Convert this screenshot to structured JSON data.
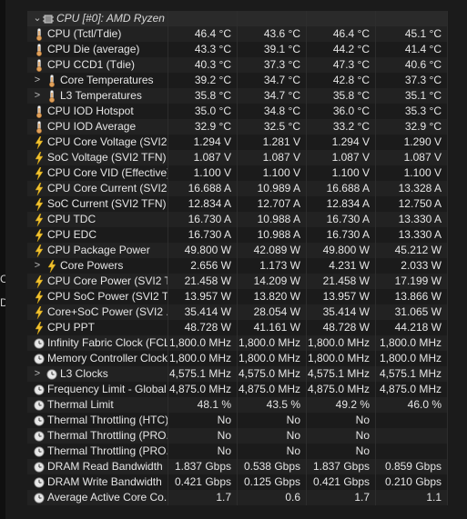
{
  "window": {
    "edge_glyphs": [
      "C",
      "D"
    ]
  },
  "group": {
    "label": "CPU [#0]: AMD Ryzen 7 ...",
    "icon": "chip-icon"
  },
  "rows": [
    {
      "icon": "thermometer-icon",
      "name": "CPU (Tctl/Tdie)",
      "v": [
        "46.4 °C",
        "43.6 °C",
        "46.4 °C",
        "45.1 °C"
      ]
    },
    {
      "icon": "thermometer-icon",
      "name": "CPU Die (average)",
      "v": [
        "43.3 °C",
        "39.1 °C",
        "44.2 °C",
        "41.4 °C"
      ]
    },
    {
      "icon": "thermometer-icon",
      "name": "CPU CCD1 (Tdie)",
      "v": [
        "40.3 °C",
        "37.3 °C",
        "47.3 °C",
        "40.6 °C"
      ]
    },
    {
      "icon": "thermometer-icon",
      "name": "Core Temperatures",
      "expand": ">",
      "sub": true,
      "v": [
        "39.2 °C",
        "34.7 °C",
        "42.8 °C",
        "37.3 °C"
      ]
    },
    {
      "icon": "thermometer-icon",
      "name": "L3 Temperatures",
      "expand": ">",
      "sub": true,
      "v": [
        "35.8 °C",
        "34.7 °C",
        "35.8 °C",
        "35.1 °C"
      ]
    },
    {
      "icon": "thermometer-icon",
      "name": "CPU IOD Hotspot",
      "v": [
        "35.0 °C",
        "34.8 °C",
        "36.0 °C",
        "35.3 °C"
      ]
    },
    {
      "icon": "thermometer-icon",
      "name": "CPU IOD Average",
      "v": [
        "32.9 °C",
        "32.5 °C",
        "33.2 °C",
        "32.9 °C"
      ]
    },
    {
      "icon": "lightning-icon",
      "name": "CPU Core Voltage (SVI2 ...",
      "v": [
        "1.294 V",
        "1.281 V",
        "1.294 V",
        "1.290 V"
      ]
    },
    {
      "icon": "lightning-icon",
      "name": "SoC Voltage (SVI2 TFN)",
      "v": [
        "1.087 V",
        "1.087 V",
        "1.087 V",
        "1.087 V"
      ]
    },
    {
      "icon": "lightning-icon",
      "name": "CPU Core VID (Effective)",
      "v": [
        "1.100 V",
        "1.100 V",
        "1.100 V",
        "1.100 V"
      ]
    },
    {
      "icon": "lightning-icon",
      "name": "CPU Core Current (SVI2 ...",
      "v": [
        "16.688 A",
        "10.989 A",
        "16.688 A",
        "13.328 A"
      ]
    },
    {
      "icon": "lightning-icon",
      "name": "SoC Current (SVI2 TFN)",
      "v": [
        "12.834 A",
        "12.707 A",
        "12.834 A",
        "12.750 A"
      ]
    },
    {
      "icon": "lightning-icon",
      "name": "CPU TDC",
      "v": [
        "16.730 A",
        "10.988 A",
        "16.730 A",
        "13.330 A"
      ]
    },
    {
      "icon": "lightning-icon",
      "name": "CPU EDC",
      "v": [
        "16.730 A",
        "10.988 A",
        "16.730 A",
        "13.330 A"
      ]
    },
    {
      "icon": "lightning-icon",
      "name": "CPU Package Power",
      "v": [
        "49.800 W",
        "42.089 W",
        "49.800 W",
        "45.212 W"
      ]
    },
    {
      "icon": "lightning-icon",
      "name": "Core Powers",
      "expand": ">",
      "sub": true,
      "v": [
        "2.656 W",
        "1.173 W",
        "4.231 W",
        "2.033 W"
      ]
    },
    {
      "icon": "lightning-icon",
      "name": "CPU Core Power (SVI2 T...",
      "v": [
        "21.458 W",
        "14.209 W",
        "21.458 W",
        "17.199 W"
      ]
    },
    {
      "icon": "lightning-icon",
      "name": "CPU SoC Power (SVI2 TFN)",
      "v": [
        "13.957 W",
        "13.820 W",
        "13.957 W",
        "13.866 W"
      ]
    },
    {
      "icon": "lightning-icon",
      "name": "Core+SoC Power (SVI2 ...",
      "v": [
        "35.414 W",
        "28.054 W",
        "35.414 W",
        "31.065 W"
      ]
    },
    {
      "icon": "lightning-icon",
      "name": "CPU PPT",
      "v": [
        "48.728 W",
        "41.161 W",
        "48.728 W",
        "44.218 W"
      ]
    },
    {
      "icon": "clock-icon",
      "name": "Infinity Fabric Clock (FCLK)",
      "v": [
        "1,800.0 MHz",
        "1,800.0 MHz",
        "1,800.0 MHz",
        "1,800.0 MHz"
      ]
    },
    {
      "icon": "clock-icon",
      "name": "Memory Controller Clock ...",
      "v": [
        "1,800.0 MHz",
        "1,800.0 MHz",
        "1,800.0 MHz",
        "1,800.0 MHz"
      ]
    },
    {
      "icon": "clock-icon",
      "name": "L3 Clocks",
      "expand": ">",
      "sub": true,
      "v": [
        "4,575.1 MHz",
        "4,575.0 MHz",
        "4,575.1 MHz",
        "4,575.1 MHz"
      ]
    },
    {
      "icon": "clock-icon",
      "name": "Frequency Limit - Global",
      "v": [
        "4,875.0 MHz",
        "4,875.0 MHz",
        "4,875.0 MHz",
        "4,875.0 MHz"
      ]
    },
    {
      "icon": "clock-icon",
      "name": "Thermal Limit",
      "v": [
        "48.1 %",
        "43.5 %",
        "49.2 %",
        "46.0 %"
      ]
    },
    {
      "icon": "clock-icon",
      "name": "Thermal Throttling (HTC)",
      "v": [
        "No",
        "No",
        "No",
        ""
      ]
    },
    {
      "icon": "clock-icon",
      "name": "Thermal Throttling (PRO...",
      "v": [
        "No",
        "No",
        "No",
        ""
      ]
    },
    {
      "icon": "clock-icon",
      "name": "Thermal Throttling (PRO...",
      "v": [
        "No",
        "No",
        "No",
        ""
      ]
    },
    {
      "icon": "clock-icon",
      "name": "DRAM Read Bandwidth",
      "v": [
        "1.837 Gbps",
        "0.538 Gbps",
        "1.837 Gbps",
        "0.859 Gbps"
      ]
    },
    {
      "icon": "clock-icon",
      "name": "DRAM Write Bandwidth",
      "v": [
        "0.421 Gbps",
        "0.125 Gbps",
        "0.421 Gbps",
        "0.210 Gbps"
      ]
    },
    {
      "icon": "clock-icon",
      "name": "Average Active Core Co...",
      "v": [
        "1.7",
        "0.6",
        "1.7",
        "1.1"
      ]
    }
  ],
  "colors": {
    "background": "#1b1b1b",
    "text": "#e6e6e6",
    "thermometer": "#e0a15a",
    "lightning": "#f2c230",
    "clock": "#cfcfcf"
  }
}
